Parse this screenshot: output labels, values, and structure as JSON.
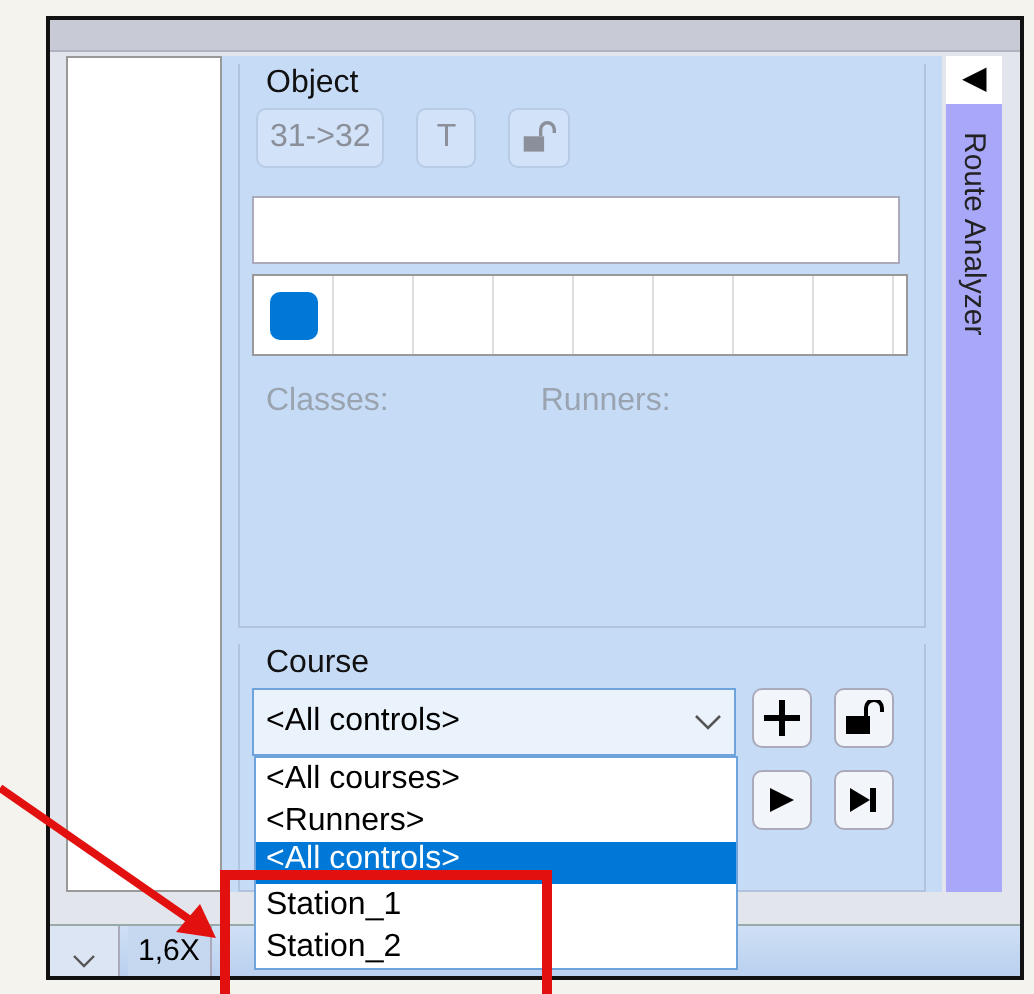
{
  "object_panel": {
    "title": "Object",
    "buttons": [
      {
        "kind": "text",
        "label": "31->32",
        "disabled": true
      },
      {
        "kind": "text",
        "label": "T",
        "disabled": true
      },
      {
        "kind": "lock",
        "disabled": true
      }
    ],
    "swatches": [
      {
        "color": "#0078d7"
      }
    ],
    "info_labels": [
      {
        "text": "Classes:",
        "disabled": true
      },
      {
        "text": "Runners:",
        "disabled": true
      }
    ]
  },
  "course_panel": {
    "title": "Course",
    "combo": {
      "value": "<All controls>",
      "expanded": true
    },
    "buttons": [
      {
        "kind": "add"
      },
      {
        "kind": "lock"
      },
      {
        "kind": "play"
      },
      {
        "kind": "skip_end"
      }
    ],
    "options": [
      {
        "label": "<All courses>",
        "selected": false
      },
      {
        "label": "<Runners>",
        "selected": false
      },
      {
        "label": "<All controls>",
        "selected": true
      },
      {
        "label": "Station_1",
        "selected": false
      },
      {
        "label": "Station_2",
        "selected": false
      }
    ]
  },
  "side_tab": {
    "collapse": "◀",
    "label": "Route Analyzer"
  },
  "status_bar": {
    "zoom": "1,6X"
  }
}
